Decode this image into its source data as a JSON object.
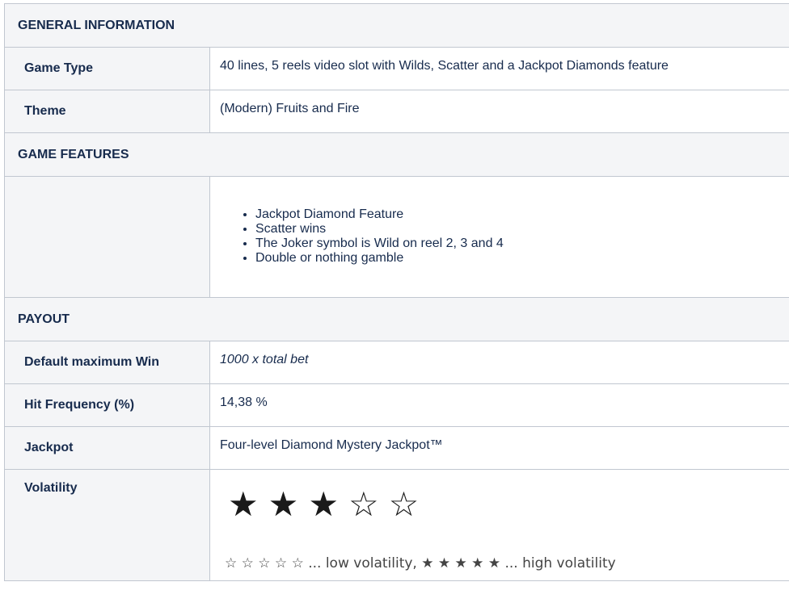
{
  "sections": {
    "general": "GENERAL INFORMATION",
    "features": "GAME FEATURES",
    "payout": "PAYOUT"
  },
  "general": {
    "game_type_label": "Game Type",
    "game_type_value": "40 lines, 5 reels video slot with Wilds, Scatter and a Jackpot Diamonds feature",
    "theme_label": "Theme",
    "theme_value": "(Modern) Fruits and Fire"
  },
  "features": {
    "items": [
      "Jackpot Diamond Feature",
      "Scatter wins",
      "The Joker symbol is Wild on reel 2, 3 and 4",
      "Double or nothing gamble"
    ]
  },
  "payout": {
    "max_win_label": "Default maximum Win",
    "max_win_value": "1000 x total bet",
    "hit_freq_label": "Hit Frequency (%)",
    "hit_freq_value": "14,38 %",
    "jackpot_label": "Jackpot",
    "jackpot_value": "Four-level Diamond Mystery Jackpot™",
    "volatility_label": "Volatility",
    "volatility_rating": 3,
    "volatility_max": 5,
    "volatility_stars": [
      "★",
      "★",
      "★",
      "☆",
      "☆"
    ],
    "volatility_legend": "☆ ☆ ☆ ☆ ☆ ... low volatility, ★ ★ ★ ★ ★ ... high volatility"
  }
}
